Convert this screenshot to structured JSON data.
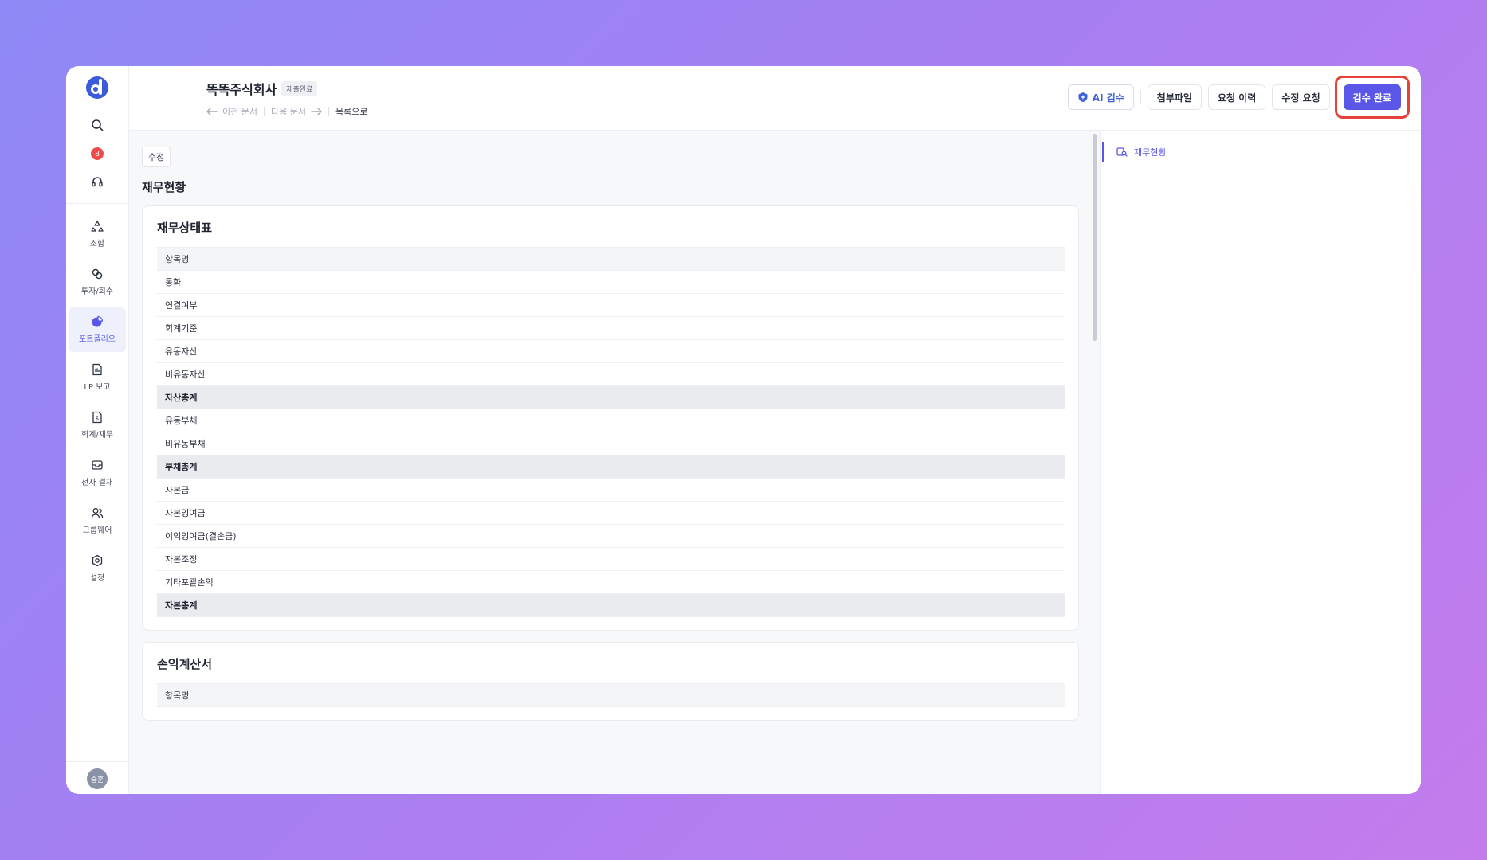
{
  "sidebar": {
    "notification_count": "8",
    "nav": [
      {
        "label": "조합",
        "icon": "recycle-icon"
      },
      {
        "label": "투자/회수",
        "icon": "investment-icon"
      },
      {
        "label": "포트폴리오",
        "icon": "portfolio-icon"
      },
      {
        "label": "LP 보고",
        "icon": "report-icon"
      },
      {
        "label": "회계/재무",
        "icon": "accounting-icon"
      },
      {
        "label": "전자 결재",
        "icon": "approval-icon"
      },
      {
        "label": "그룹웨어",
        "icon": "groupware-icon"
      },
      {
        "label": "설정",
        "icon": "settings-icon"
      }
    ],
    "avatar_text": "승훈"
  },
  "header": {
    "company": "똑똑주식회사",
    "status": "제출완료",
    "prev": "이전 문서",
    "next": "다음 문서",
    "back": "목록으로",
    "buttons": {
      "ai_review": "AI 검수",
      "attachments": "첨부파일",
      "request_history": "요청 이력",
      "edit_request": "수정 요청",
      "complete_review": "검수 완료"
    }
  },
  "main": {
    "edit_tag": "수정",
    "section_title": "재무현황",
    "balance_sheet": {
      "title": "재무상태표",
      "header": "항목명",
      "rows": [
        {
          "label": "통화",
          "total": false
        },
        {
          "label": "연결여부",
          "total": false
        },
        {
          "label": "회계기준",
          "total": false
        },
        {
          "label": "유동자산",
          "total": false
        },
        {
          "label": "비유동자산",
          "total": false
        },
        {
          "label": "자산총계",
          "total": true
        },
        {
          "label": "유동부채",
          "total": false
        },
        {
          "label": "비유동부채",
          "total": false
        },
        {
          "label": "부채총계",
          "total": true
        },
        {
          "label": "자본금",
          "total": false
        },
        {
          "label": "자본잉여금",
          "total": false
        },
        {
          "label": "이익잉여금(결손금)",
          "total": false
        },
        {
          "label": "자본조정",
          "total": false
        },
        {
          "label": "기타포괄손익",
          "total": false
        },
        {
          "label": "자본총계",
          "total": true
        }
      ]
    },
    "income_statement": {
      "title": "손익계산서",
      "header": "항목명"
    }
  },
  "toc": {
    "items": [
      "재무현황"
    ]
  },
  "colors": {
    "accent": "#5a57e8",
    "highlight": "#e8403a",
    "badge": "#ef4a4a"
  }
}
